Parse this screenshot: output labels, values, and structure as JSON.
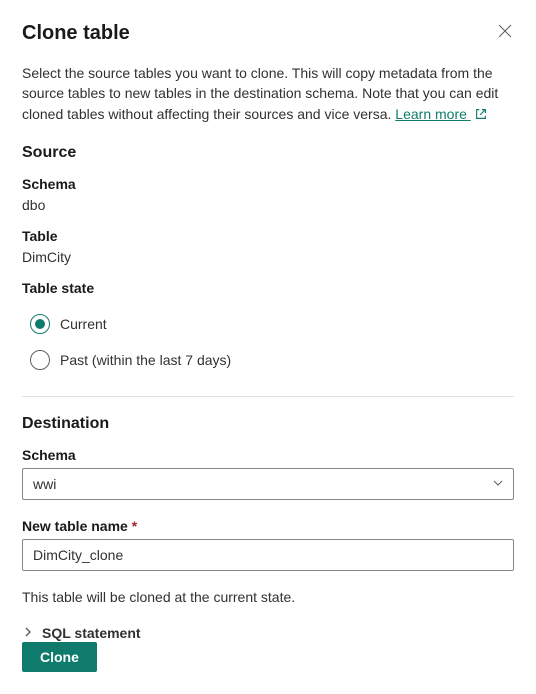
{
  "dialog": {
    "title": "Clone table",
    "description": "Select the source tables you want to clone. This will copy metadata from the source tables to new tables in the destination schema. Note that you can edit cloned tables without affecting their sources and vice versa. ",
    "learn_more": "Learn more "
  },
  "source": {
    "heading": "Source",
    "schema_label": "Schema",
    "schema_value": "dbo",
    "table_label": "Table",
    "table_value": "DimCity",
    "state_label": "Table state",
    "state_options": {
      "current": "Current",
      "past": "Past (within the last 7 days)"
    },
    "state_selected": "current"
  },
  "destination": {
    "heading": "Destination",
    "schema_label": "Schema",
    "schema_value": "wwi",
    "name_label": "New table name",
    "name_value": "DimCity_clone"
  },
  "hint": "This table will be cloned at the current state.",
  "sql_expander": "SQL statement",
  "buttons": {
    "clone": "Clone"
  }
}
